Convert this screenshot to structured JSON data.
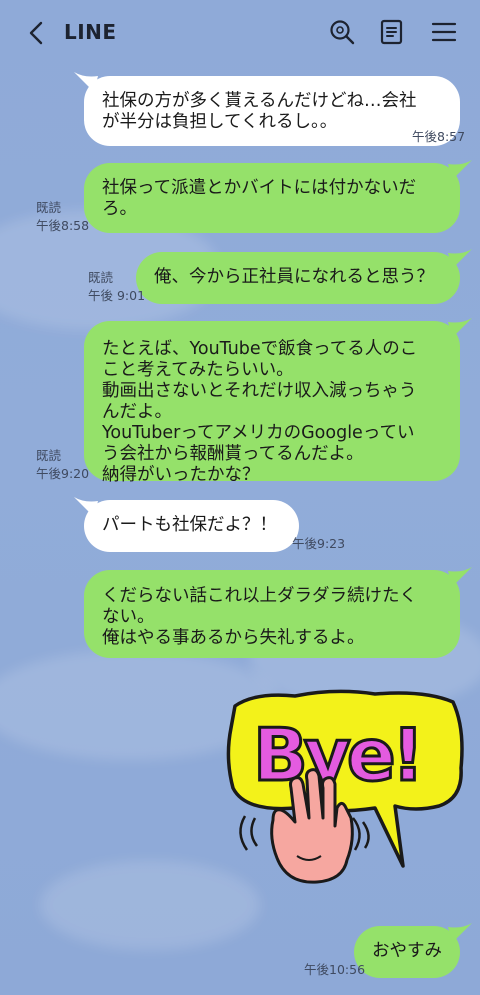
{
  "header": {
    "title": "LINE",
    "back_icon": "chevron-left-icon",
    "icons": [
      "search-icon",
      "note-icon",
      "menu-icon"
    ]
  },
  "messages": [
    {
      "side": "received",
      "text": "社保の方が多く貰えるんだけどね…会社\nが半分は負担してくれるし。。",
      "time": "午後8:57",
      "read": ""
    },
    {
      "side": "sent",
      "text": "社保って派遣とかバイトには付かないだ\nろ。",
      "time": "午後8:58",
      "read": "既読"
    },
    {
      "side": "sent",
      "text": "俺、今から正社員になれると思う？",
      "time": "午後 9:01",
      "read": "既読"
    },
    {
      "side": "sent",
      "text": "たとえば、YouTubeで飯食ってる人のこ\nこと考えてみたらいい。\n動画出さないとそれだけ収入減っちゃう\nんだよ。\nYouTuberってアメリカのGoogleってい\nう会社から報酬貰ってるんだよ。\n納得がいったかな？",
      "time": "午後9:20",
      "read": "既読"
    },
    {
      "side": "received",
      "text": "パートも社保だよ？！",
      "time": "午後9:23",
      "read": ""
    },
    {
      "side": "sent",
      "text": "くだらない話これ以上ダラダラ続けたく\nない。\n俺はやる事あるから失礼するよ。",
      "time": "",
      "read": ""
    },
    {
      "side": "sent",
      "sticker": "Bye!",
      "time": "",
      "read": ""
    },
    {
      "side": "sent",
      "text": "おやすみ",
      "time": "午後10:56",
      "read": ""
    }
  ],
  "colors": {
    "sent": "#95e16a",
    "received": "#ffffff",
    "background": "#8faad8"
  }
}
